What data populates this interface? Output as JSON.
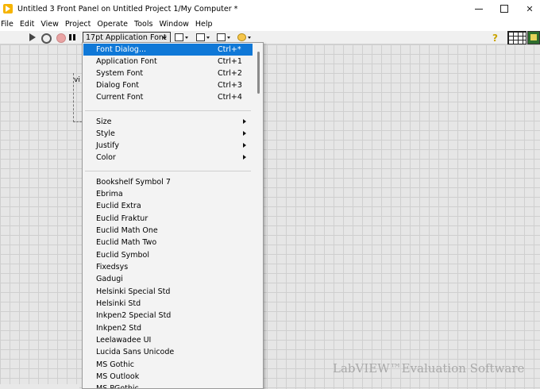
{
  "window": {
    "title": "Untitled 3 Front Panel on Untitled Project 1/My Computer *",
    "minimize_glyph": "",
    "maximize_glyph": "",
    "close_glyph": "✕"
  },
  "menubar": {
    "items": [
      "File",
      "Edit",
      "View",
      "Project",
      "Operate",
      "Tools",
      "Window",
      "Help"
    ]
  },
  "toolbar": {
    "font_selector": "17pt Application Font",
    "help_glyph": "?"
  },
  "canvas": {
    "label_fragment": "vi",
    "watermark": "LabVIEW™Evaluation Software"
  },
  "font_menu": {
    "top_items": [
      {
        "label": "Font Dialog...",
        "shortcut": "Ctrl+*",
        "highlighted": true
      },
      {
        "label": "Application Font",
        "shortcut": "Ctrl+1"
      },
      {
        "label": "System Font",
        "shortcut": "Ctrl+2"
      },
      {
        "label": "Dialog Font",
        "shortcut": "Ctrl+3"
      },
      {
        "label": "Current Font",
        "shortcut": "Ctrl+4"
      }
    ],
    "submenus": [
      "Size",
      "Style",
      "Justify",
      "Color"
    ],
    "fonts": [
      "Bookshelf Symbol 7",
      "Ebrima",
      "Euclid Extra",
      "Euclid Fraktur",
      "Euclid Math One",
      "Euclid Math Two",
      "Euclid Symbol",
      "Fixedsys",
      "Gadugi",
      "Helsinki Special Std",
      "Helsinki Std",
      "Inkpen2 Special Std",
      "Inkpen2 Std",
      "Leelawadee UI",
      "Lucida Sans Unicode",
      "MS Gothic",
      "MS Outlook",
      "MS PGothic"
    ]
  },
  "colors": {
    "highlight": "#0f78d7",
    "menu_bg": "#f3f3f3",
    "canvas_bg": "#e6e6e6",
    "grid": "#cfcfcf"
  }
}
